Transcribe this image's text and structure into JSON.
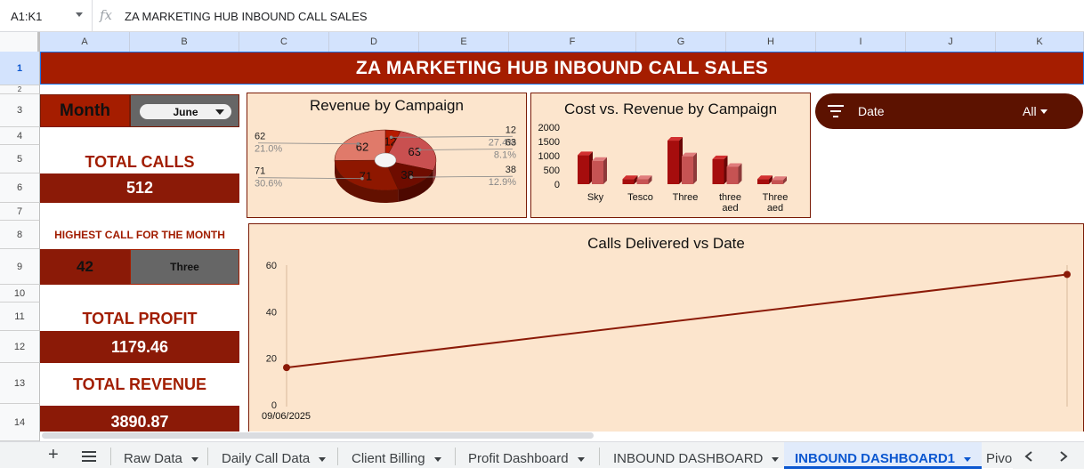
{
  "formula_bar": {
    "cell_ref": "A1:K1",
    "fx_symbol": "fx",
    "formula": "ZA MARKETING HUB INBOUND CALL SALES"
  },
  "columns": [
    "A",
    "B",
    "C",
    "D",
    "E",
    "F",
    "G",
    "H",
    "I",
    "J",
    "K"
  ],
  "rows": [
    "1",
    "2",
    "3",
    "4",
    "5",
    "6",
    "7",
    "8",
    "9",
    "10",
    "11",
    "12",
    "13",
    "14"
  ],
  "title": "ZA MARKETING HUB INBOUND CALL SALES",
  "month": {
    "label": "Month",
    "value": "June"
  },
  "total_calls": {
    "label": "TOTAL CALLS",
    "value": "512"
  },
  "highest_call": {
    "label": "HIGHEST CALL FOR THE MONTH",
    "value": "42",
    "campaign": "Three"
  },
  "total_profit": {
    "label": "TOTAL PROFIT",
    "value": "1179.46"
  },
  "total_revenue": {
    "label": "TOTAL REVENUE",
    "value": "3890.87"
  },
  "filter": {
    "label": "Date",
    "value": "All"
  },
  "colors": {
    "brand_red": "#a51d00",
    "box_red": "#8b1a07",
    "chart_bg": "#fce5cd",
    "filter_bg": "#5c1200",
    "active_tab": "#0b57d0"
  },
  "chart_data": [
    {
      "type": "pie",
      "title": "Revenue by Campaign",
      "slices": [
        {
          "value": 12,
          "percent": "27.4%",
          "color": "#b51b00"
        },
        {
          "value": 63,
          "percent": "8.1%",
          "color": "#c95050"
        },
        {
          "value": 38,
          "percent": "12.9%",
          "color": "#6e0c00"
        },
        {
          "value": 71,
          "percent": "30.6%",
          "color": "#8e1700"
        },
        {
          "value": 62,
          "percent": "21.0%",
          "color": "#e07a6a"
        }
      ]
    },
    {
      "type": "bar",
      "title": "Cost vs. Revenue by Campaign",
      "categories": [
        "Sky",
        "Tesco",
        "Three",
        "three aed",
        "Three aed"
      ],
      "category_lines": [
        [
          "Sky"
        ],
        [
          "Tesco"
        ],
        [
          "Three"
        ],
        [
          "three",
          "aed"
        ],
        [
          "Three",
          "aed"
        ]
      ],
      "yticks": [
        "2000",
        "1500",
        "1000",
        "500",
        "0"
      ],
      "ylim": [
        0,
        2000
      ],
      "series": [
        {
          "values": [
            1020,
            180,
            1530,
            880,
            180
          ],
          "color": "#a60d0d"
        },
        {
          "values": [
            820,
            180,
            980,
            610,
            150
          ],
          "color": "#c65353"
        }
      ]
    },
    {
      "type": "line",
      "title": "Calls Delivered vs Date",
      "x": [
        "09/06/2025",
        ""
      ],
      "y": [
        16,
        56
      ],
      "yticks": [
        "60",
        "40",
        "20",
        "0"
      ],
      "ylim": [
        0,
        60
      ],
      "color": "#8b1a07"
    }
  ],
  "tabs": {
    "add_icon": "+",
    "items": [
      {
        "label": "Raw Data"
      },
      {
        "label": "Daily Call Data"
      },
      {
        "label": "Client Billing"
      },
      {
        "label": "Profit Dashboard"
      },
      {
        "label": "INBOUND DASHBOARD"
      },
      {
        "label": "INBOUND DASHBOARD1"
      },
      {
        "label": "Pivo"
      }
    ],
    "active_index": 5
  }
}
